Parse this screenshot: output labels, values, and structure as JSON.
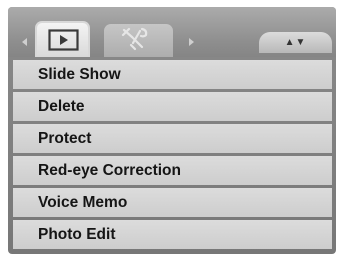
{
  "tabs": [
    {
      "icon": "play-icon",
      "active": true
    },
    {
      "icon": "wrench-icon",
      "active": false
    }
  ],
  "page_indicator": "▲▼",
  "menu": {
    "items": [
      {
        "label": "Slide Show"
      },
      {
        "label": "Delete"
      },
      {
        "label": "Protect"
      },
      {
        "label": "Red-eye Correction"
      },
      {
        "label": "Voice Memo"
      },
      {
        "label": "Photo Edit"
      }
    ]
  },
  "colors": {
    "frame": "#858585",
    "item": "#d4d4d4",
    "active_tab": "#ececec",
    "inactive_tab": "#b8b8b8",
    "text": "#151515"
  }
}
